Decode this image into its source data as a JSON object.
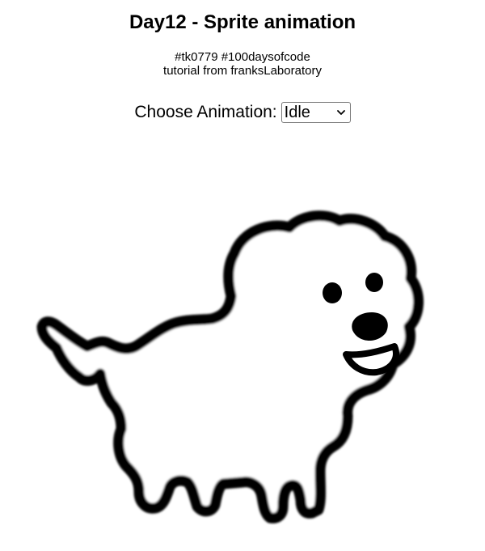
{
  "header": {
    "title": "Day12 - Sprite animation",
    "subtitle_line1": "#tk0779 #100daysofcode",
    "subtitle_line2": "tutorial from franksLaboratory"
  },
  "controls": {
    "label": "Choose Animation:",
    "selected": "Idle"
  },
  "sprite": {
    "icon": "dog-sprite-icon"
  }
}
